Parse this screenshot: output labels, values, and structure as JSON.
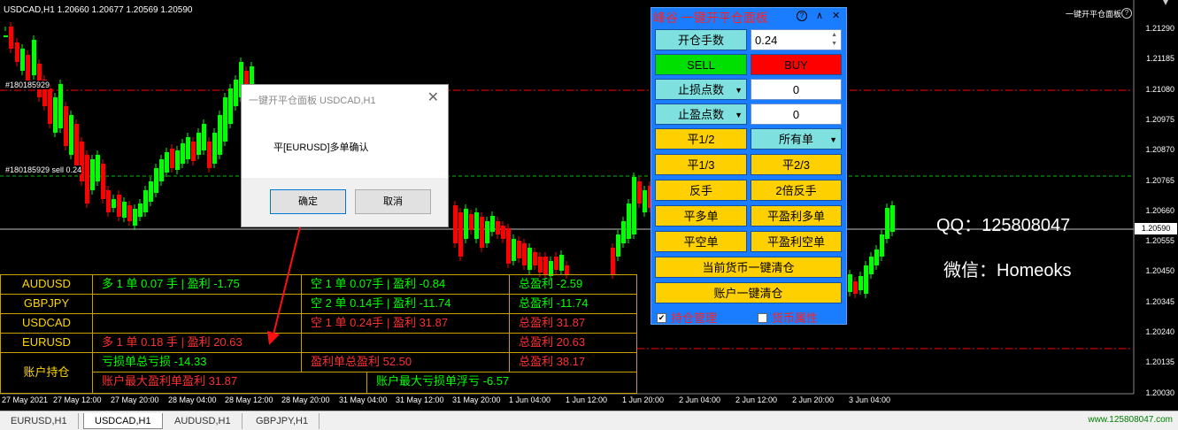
{
  "chart": {
    "header": "USDCAD,H1  1.20660 1.20677 1.20569 1.20590",
    "panel_label": "一键开平仓面板",
    "order_labels": [
      "#180185929",
      "#180185929 sell 0.24"
    ],
    "price_axis": [
      "1.21290",
      "1.21185",
      "1.21080",
      "1.20975",
      "1.20870",
      "1.20765",
      "1.20660",
      "1.20555",
      "1.20450",
      "1.20345",
      "1.20240",
      "1.20135",
      "1.20030"
    ],
    "current_price": "1.20590",
    "time_axis": [
      "27 May 2021",
      "27 May 12:00",
      "27 May 20:00",
      "28 May 04:00",
      "28 May 12:00",
      "28 May 20:00",
      "31 May 04:00",
      "31 May 12:00",
      "31 May 20:00",
      "1 Jun 04:00",
      "1 Jun 12:00",
      "1 Jun 20:00",
      "2 Jun 04:00",
      "2 Jun 12:00",
      "2 Jun 20:00",
      "3 Jun 04:00"
    ],
    "qq": "QQ：125808047",
    "wechat": "微信：Homeoks",
    "colors": {
      "up": "#00ff00",
      "down": "#ff0000",
      "sl_line": "#ff0000",
      "order_line": "#00c000",
      "bid_line": "#c0c0c0"
    }
  },
  "dialog": {
    "title": "一键开平仓面板 USDCAD,H1",
    "close_icon": "close-icon",
    "message": "平[EURUSD]多单确认",
    "ok_label": "确定",
    "cancel_label": "取消"
  },
  "positions": {
    "rows": [
      {
        "symbol": "AUDUSD",
        "long": "多 1 单 0.07 手 | 盈利 -1.75",
        "short": "空 1 单 0.07手 | 盈利 -0.84",
        "total": "总盈利 -2.59"
      },
      {
        "symbol": "GBPJPY",
        "long": "",
        "short": "空 2 单 0.14手 | 盈利 -11.74",
        "total": "总盈利 -11.74"
      },
      {
        "symbol": "USDCAD",
        "long": "",
        "short": "空 1 单 0.24手 | 盈利 31.87",
        "total": "总盈利 31.87"
      },
      {
        "symbol": "EURUSD",
        "long": "多 1 单 0.18 手 | 盈利 20.63",
        "short": "",
        "total": "总盈利 20.63"
      }
    ],
    "account_label": "账户持仓",
    "loss_total": "亏损单总亏损  -14.33",
    "profit_total": "盈利单总盈利 52.50",
    "grand_total": "总盈利 38.17",
    "max_profit": "账户最大盈利单盈利 31.87",
    "max_loss": "账户最大亏损单浮亏 -6.57"
  },
  "panel": {
    "title": "峰谷 一键开平仓面板",
    "help_icon": "help-icon",
    "collapse_icon": "chevron-up-icon",
    "close_icon": "close-icon",
    "lot_label": "开仓手数",
    "lot_value": "0.24",
    "sell_label": "SELL",
    "buy_label": "BUY",
    "sl_label": "止损点数",
    "sl_value": "0",
    "tp_label": "止盈点数",
    "tp_value": "0",
    "half_close": "平1/2",
    "order_scope": "所有单",
    "third_close": "平1/3",
    "two_third_close": "平2/3",
    "reverse": "反手",
    "double_reverse": "2倍反手",
    "close_long": "平多单",
    "close_profit_long": "平盈利多单",
    "close_short": "平空单",
    "close_profit_short": "平盈利空单",
    "close_symbol_all": "当前货币一键清仓",
    "close_account_all": "账户一键清仓",
    "check_positions": "持仓管理",
    "check_positions_checked": "✔",
    "check_symbol": "货币属性"
  },
  "tabs": [
    "EURUSD,H1",
    "USDCAD,H1",
    "AUDUSD,H1",
    "GBPJPY,H1"
  ],
  "active_tab": "USDCAD,H1",
  "site": "www.125808047.com"
}
